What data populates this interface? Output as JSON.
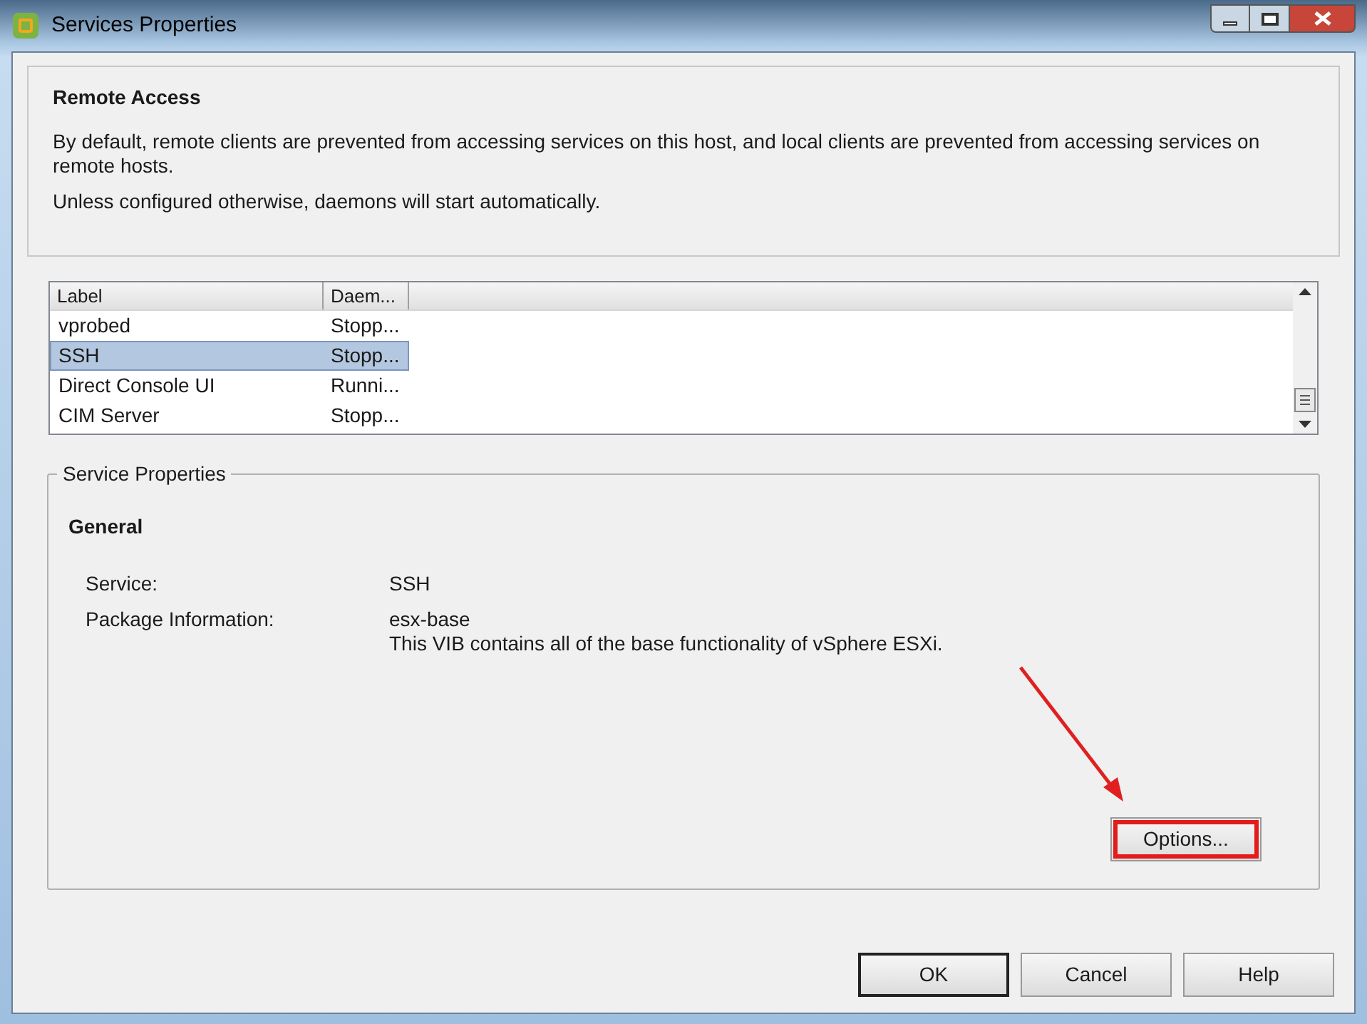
{
  "window": {
    "title": "Services Properties"
  },
  "remote_access": {
    "heading": "Remote Access",
    "paragraphs": [
      "By default, remote clients are prevented from accessing services on this host, and local clients are prevented from accessing services on remote hosts.",
      "Unless configured otherwise, daemons will start automatically."
    ]
  },
  "table": {
    "columns": [
      "Label",
      "Daem..."
    ],
    "rows": [
      {
        "cells": [
          "vprobed",
          "Stopp..."
        ],
        "selected": false
      },
      {
        "cells": [
          "SSH",
          "Stopp..."
        ],
        "selected": true
      },
      {
        "cells": [
          "Direct Console UI",
          "Runni..."
        ],
        "selected": false
      },
      {
        "cells": [
          "CIM Server",
          "Stopp..."
        ],
        "selected": false
      }
    ]
  },
  "service_properties": {
    "legend": "Service Properties",
    "heading": "General",
    "fields": [
      {
        "label": "Service:",
        "lines": [
          "SSH"
        ]
      },
      {
        "label": "Package Information:",
        "lines": [
          "esx-base",
          "This VIB contains all of the base functionality of vSphere ESXi."
        ]
      }
    ],
    "options_button": {
      "label": "Options...",
      "highlighted": true
    }
  },
  "buttons": [
    {
      "label": "OK",
      "default": true
    },
    {
      "label": "Cancel",
      "default": false
    },
    {
      "label": "Help",
      "default": false
    }
  ]
}
